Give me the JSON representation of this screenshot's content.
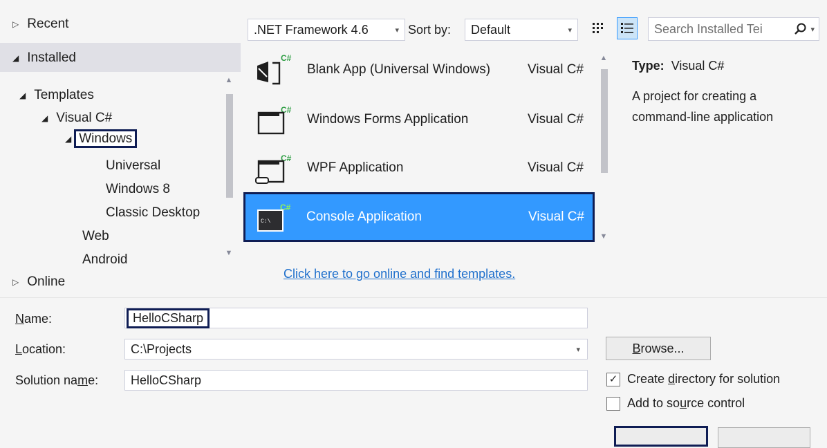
{
  "tree": {
    "recent": "Recent",
    "installed": "Installed",
    "templates": "Templates",
    "visual_csharp": "Visual C#",
    "windows": "Windows",
    "universal": "Universal",
    "windows8": "Windows 8",
    "classic_desktop": "Classic Desktop",
    "web": "Web",
    "android": "Android",
    "online": "Online"
  },
  "toolbar": {
    "framework": ".NET Framework 4.6",
    "sort_label": "Sort by:",
    "sort_value": "Default",
    "search_placeholder": "Search Installed Tei"
  },
  "templates": [
    {
      "name": "Blank App (Universal Windows)",
      "lang": "Visual C#",
      "icon": "blank-app-icon"
    },
    {
      "name": "Windows Forms Application",
      "lang": "Visual C#",
      "icon": "windows-forms-icon"
    },
    {
      "name": "WPF Application",
      "lang": "Visual C#",
      "icon": "wpf-icon"
    },
    {
      "name": "Console Application",
      "lang": "Visual C#",
      "icon": "console-icon",
      "selected": true
    }
  ],
  "online_link": "Click here to go online and find templates.",
  "details": {
    "type_label": "Type:",
    "type_value": "Visual C#",
    "description": "A project for creating a command-line  application"
  },
  "form": {
    "name_label_u": "N",
    "name_label_rest": "ame:",
    "name_value": "HelloCSharp",
    "location_label_u": "L",
    "location_label_rest": "ocation:",
    "location_value": "C:\\Projects",
    "solution_label_pre": "Solution na",
    "solution_label_u": "m",
    "solution_label_post": "e:",
    "solution_value": "HelloCSharp",
    "browse_u": "B",
    "browse_rest": "rowse...",
    "create_dir_pre": "Create ",
    "create_dir_u": "d",
    "create_dir_post": "irectory for solution",
    "create_dir_checked": true,
    "source_pre": "Add to so",
    "source_u": "u",
    "source_post": "rce control",
    "source_checked": false
  },
  "colors": {
    "selection": "#3399ff",
    "highlight_border": "#0f1d54",
    "link": "#1e6fcc"
  }
}
